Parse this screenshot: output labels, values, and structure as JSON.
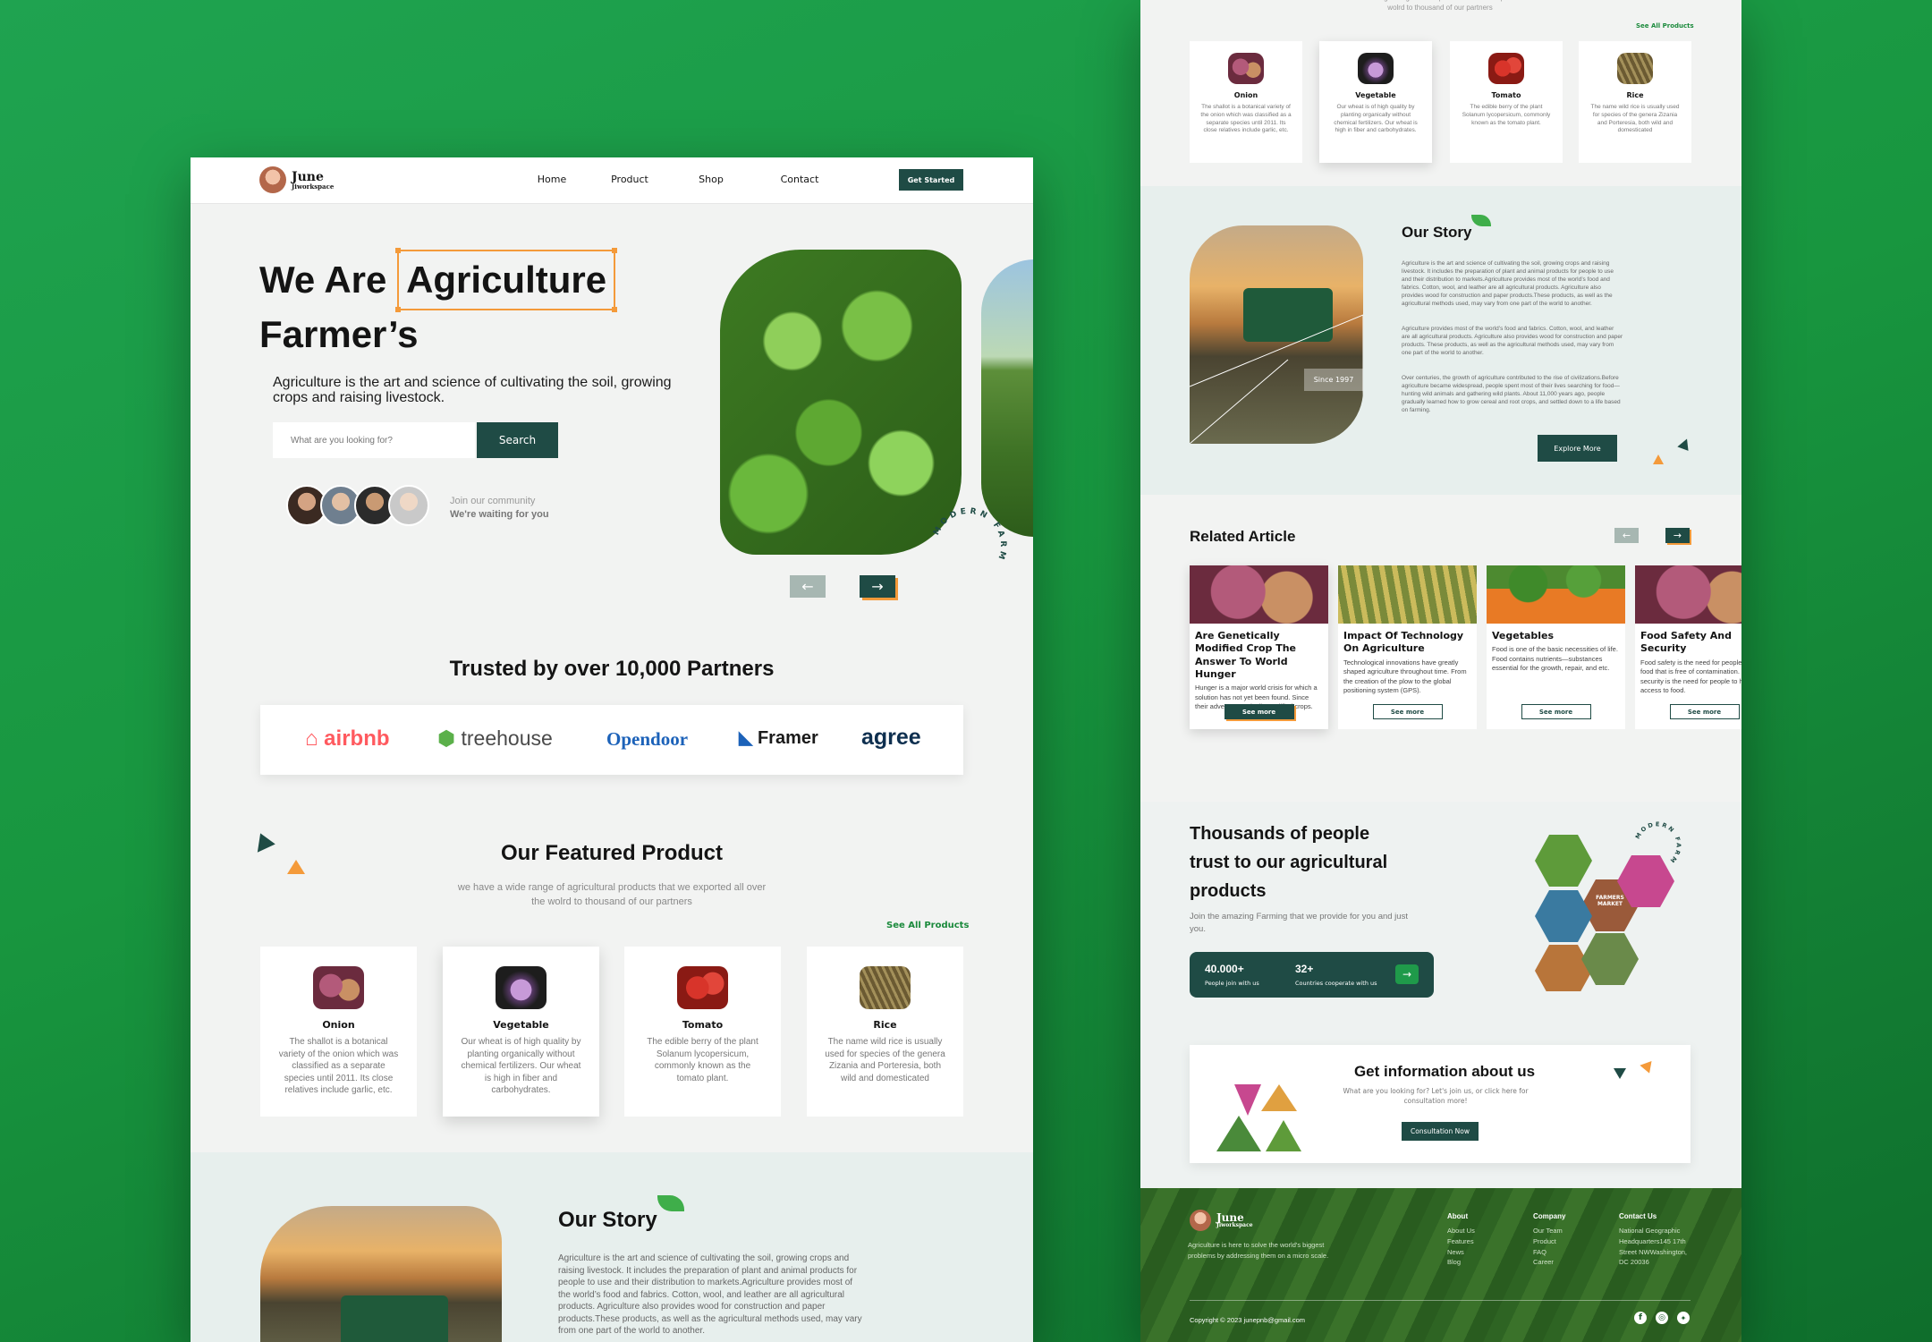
{
  "brand": {
    "name": "June",
    "sub": "Jiworkspace"
  },
  "nav": {
    "items": [
      "Home",
      "Product",
      "Shop",
      "Contact"
    ],
    "cta": "Get Started"
  },
  "hero": {
    "title_pre": "We Are",
    "title_highlight": "Agriculture",
    "title_line2": "Farmer’s",
    "subtitle": "Agriculture is the art and science of cultivating the soil, growing crops and raising livestock.",
    "search_placeholder": "What are you looking for?",
    "search_button": "Search",
    "community_line1": "Join our community",
    "community_line2": "We're waiting for you",
    "badge_text": "MODERN FARM",
    "prev_icon": "arrow-left-icon",
    "next_icon": "arrow-right-icon"
  },
  "partners": {
    "title": "Trusted by over 10,000 Partners",
    "logos": [
      {
        "name": "airbnb",
        "color": "#ff5a5f"
      },
      {
        "name": "treehouse",
        "color": "#4a4a4a"
      },
      {
        "name": "Opendoor",
        "color": "#1c62b9"
      },
      {
        "name": "Framer",
        "color": "#1a1a1a"
      },
      {
        "name": "agree",
        "color": "#0e2f4f"
      }
    ]
  },
  "featured": {
    "title": "Our Featured Product",
    "subtitle": "we have a wide range of agricultural products that we exported all over the wolrd to thousand of our partners",
    "see_all": "See All Products",
    "products": [
      {
        "name": "Onion",
        "desc": "The shallot is a botanical variety of the onion which was classified as a separate species until 2011. Its close relatives include garlic, etc."
      },
      {
        "name": "Vegetable",
        "desc": "Our wheat is of high quality by planting organically without chemical fertilizers. Our wheat is high in fiber and carbohydrates."
      },
      {
        "name": "Tomato",
        "desc": "The edible berry of the plant Solanum lycopersicum, commonly known as the tomato plant."
      },
      {
        "name": "Rice",
        "desc": "The name wild rice is usually used for species of the genera Zizania and Porteresia, both wild and domesticated"
      }
    ]
  },
  "story": {
    "title": "Our Story",
    "p1": "Agriculture is the art and science of cultivating the soil, growing crops and raising livestock. It includes the preparation of plant and animal products for people to use and their distribution to markets.Agriculture provides most of the world’s food and fabrics. Cotton, wool, and leather are all agricultural products. Agriculture also provides wood for construction and paper products.These products, as well as the agricultural methods used, may vary from one part of the world to another.",
    "p2": "Agriculture provides most of the world’s food and fabrics. Cotton, wool, and leather are all agricultural products. Agriculture also provides wood for construction and paper products. These products, as well as the agricultural methods used, may vary from one part of the world to another.",
    "p3": "Over centuries, the growth of agriculture contributed to the rise of civilizations.Before agriculture became widespread, people spent most of their lives searching for food—hunting wild animals and gathering wild plants. About 11,000 years ago, people gradually learned how to grow cereal and root crops, and settled down to a life based on farming.",
    "since": "Since 1997",
    "button": "Explore More"
  },
  "articles": {
    "title": "Related Article",
    "items": [
      {
        "title": "Are Genetically Modified Crop The Answer To World Hunger",
        "desc": "Hunger is a major world crisis for which a solution has not yet been found. Since their advent, genetically modified crops.",
        "button": "See more"
      },
      {
        "title": "Impact Of Technology On Agriculture",
        "desc": "Technological innovations have greatly shaped agriculture throughout time. From the creation of the plow to the global positioning system (GPS).",
        "button": "See more"
      },
      {
        "title": "Vegetables",
        "desc": "Food is one of the basic necessities of life. Food contains nutrients—substances essential for the growth, repair, and etc.",
        "button": "See more"
      },
      {
        "title": "Food Safety And Security",
        "desc": "Food safety is the need for people to have food that is free of contamination. Food security is the need for people to have access to food.",
        "button": "See more"
      }
    ]
  },
  "trust": {
    "title": "Thousands of people trust to our agricultural products",
    "subtitle": "Join the amazing Farming that we provide for you and just you.",
    "stat1_value": "40.000+",
    "stat1_label": "People join with us",
    "stat2_value": "32+",
    "stat2_label": "Countries cooperate with us",
    "hex_label": "FARMERS MARKET"
  },
  "info": {
    "title": "Get information about us",
    "subtitle": "What are you looking for? Let's join us, or click here for consultation more!",
    "button": "Consultation Now"
  },
  "footer": {
    "tagline": "Agriculture is here to solve the world's biggest problems by addressing them on a micro scale.",
    "cols": [
      {
        "title": "About",
        "items": [
          "About Us",
          "Features",
          "News",
          "Blog"
        ]
      },
      {
        "title": "Company",
        "items": [
          "Our Team",
          "Product",
          "FAQ",
          "Career"
        ]
      },
      {
        "title": "Contact Us",
        "items": [
          "National Geographic",
          "Headquarters145 17th",
          "Street NWWashington,",
          "DC 20036"
        ]
      }
    ],
    "copyright": "Copyright © 2023 junepnb@gmail.com",
    "social": [
      "facebook-icon",
      "instagram-icon",
      "twitter-icon"
    ]
  },
  "colors": {
    "accent": "#1f4b45",
    "orange": "#f49a3a",
    "green": "#1b8a3c",
    "bg": "#f2f3f2"
  }
}
